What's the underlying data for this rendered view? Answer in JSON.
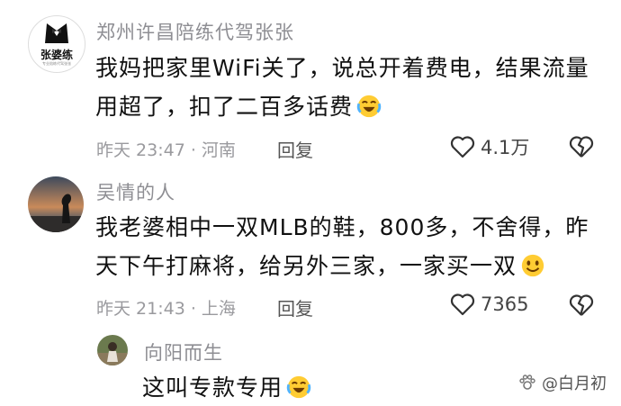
{
  "comments": [
    {
      "user": "郑州许昌陪练代驾张张",
      "avatar_text": "张婆练",
      "avatar_subtext": "专业陪练代驾张张",
      "lines": [
        "我妈把家里WiFi关了，说总开着费电，结果流量",
        "用超了，扣了二百多话费"
      ],
      "time": "昨天 23:47 · 河南",
      "reply": "回复",
      "likes": "4.1万"
    },
    {
      "user": "吴情的人",
      "lines": [
        "我老婆相中一双MLB的鞋，800多，不舍得，昨",
        "天下午打麻将，给另外三家，一家买一双"
      ],
      "time": "昨天 21:43 · 上海",
      "reply": "回复",
      "likes": "7365"
    },
    {
      "user": "向阳而生",
      "lines": [
        "这叫专款专用"
      ]
    }
  ],
  "watermark": "@白月初",
  "colors": {
    "text": "#111111",
    "meta": "#9a9a9e",
    "name": "#8e8e93"
  }
}
